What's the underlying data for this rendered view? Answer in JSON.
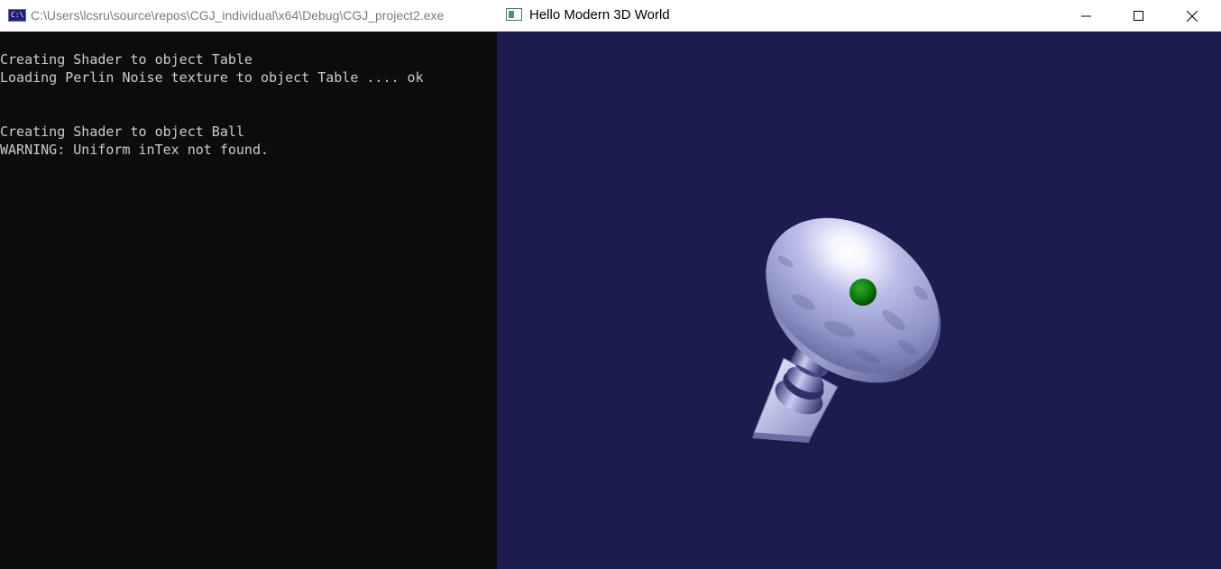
{
  "console_window": {
    "title": "C:\\Users\\lcsru\\source\\repos\\CGJ_individual\\x64\\Debug\\CGJ_project2.exe",
    "icon": "console-app-icon",
    "icon_text": "C:\\",
    "lines": [
      "Creating Shader to object Table",
      "Loading Perlin Noise texture to object Table .... ok",
      "",
      "",
      "Creating Shader to object Ball",
      "WARNING: Uniform inTex not found."
    ]
  },
  "gl_window": {
    "title": "Hello Modern 3D World",
    "icon": "app-window-icon",
    "controls": [
      "minimize-icon",
      "maximize-icon",
      "close-icon"
    ],
    "background_color": "#1c1c4f",
    "scene_objects": [
      "table-top",
      "table-pedestal",
      "table-base",
      "ball"
    ],
    "ball_color": "#0b7a0b",
    "table_color": "#b9bde6"
  }
}
